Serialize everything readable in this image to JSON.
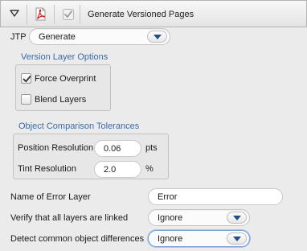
{
  "header": {
    "title": "Generate Versioned Pages",
    "icons": [
      "disclosure-triangle-icon",
      "pdf-icon",
      "checkmark-icon"
    ]
  },
  "jtp": {
    "label": "JTP",
    "value": "Generate"
  },
  "version_layer_options": {
    "title": "Version Layer Options",
    "force_overprint": {
      "label": "Force Overprint",
      "checked": true
    },
    "blend_layers": {
      "label": "Blend Layers",
      "checked": false
    }
  },
  "tolerances": {
    "title": "Object Comparison Tolerances",
    "position": {
      "label": "Position Resolution",
      "value": "0.06",
      "unit": "pts"
    },
    "tint": {
      "label": "Tint Resolution",
      "value": "2.0",
      "unit": "%"
    }
  },
  "error_layer": {
    "label": "Name of Error Layer",
    "value": "Error"
  },
  "verify_layers": {
    "label": "Verify that all layers are linked",
    "value": "Ignore"
  },
  "detect_differences": {
    "label": "Detect common object differences",
    "value": "Ignore"
  },
  "colors": {
    "group_title": "#3b6aa5",
    "chevron": "#1f4e8c",
    "pdf_red": "#d42020"
  }
}
